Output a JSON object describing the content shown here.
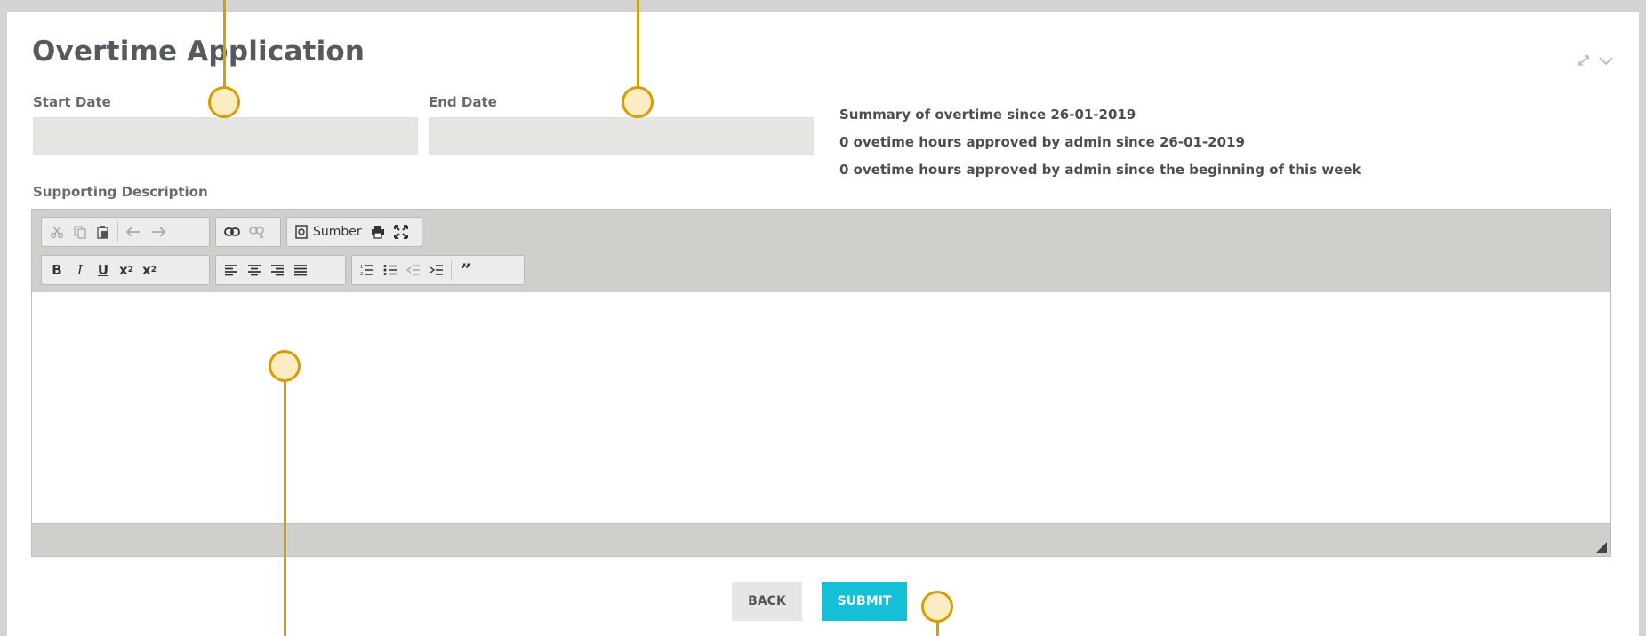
{
  "form": {
    "title": "Overtime Application",
    "start_date": {
      "label": "Start Date",
      "value": ""
    },
    "end_date": {
      "label": "End Date",
      "value": ""
    },
    "summary": [
      "Summary of overtime since 26-01-2019",
      "0 ovetime hours approved by admin since 26-01-2019",
      "0 ovetime hours approved by admin since the beginning of this week"
    ],
    "description_label": "Supporting Description",
    "editor": {
      "source_label": "Sumber",
      "content": ""
    },
    "buttons": {
      "back": "BACK",
      "submit": "SUBMIT"
    }
  },
  "window_controls": [
    "expand-icon",
    "chevron-down-icon"
  ],
  "colors": {
    "submit_bg": "#13c0d7",
    "callout": "#d79e00",
    "input_bg": "#e5e5e2"
  }
}
